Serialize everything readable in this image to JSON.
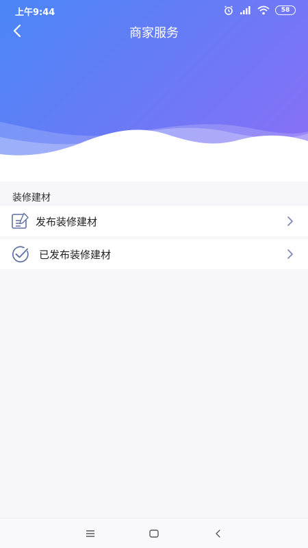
{
  "status_bar": {
    "time": "上午9:44",
    "battery": "58",
    "icons": [
      "alarm-icon",
      "signal-icon",
      "wifi-icon",
      "battery-icon"
    ]
  },
  "nav": {
    "title": "商家服务",
    "back_icon": "back-arrow-icon"
  },
  "section": {
    "title": "装修建材"
  },
  "menu": [
    {
      "label": "发布装修建材",
      "icon": "edit-document-icon"
    },
    {
      "label": "已发布装修建材",
      "icon": "check-circle-icon"
    }
  ],
  "system_nav": {
    "icons": [
      "menu-icon",
      "home-icon",
      "back-icon"
    ]
  },
  "colors": {
    "gradient_start": "#4a86f7",
    "gradient_end": "#8d6ef6",
    "icon_stroke": "#5f6fa3",
    "chevron": "#7b8ab8",
    "page_bg": "#f7f7fa"
  }
}
